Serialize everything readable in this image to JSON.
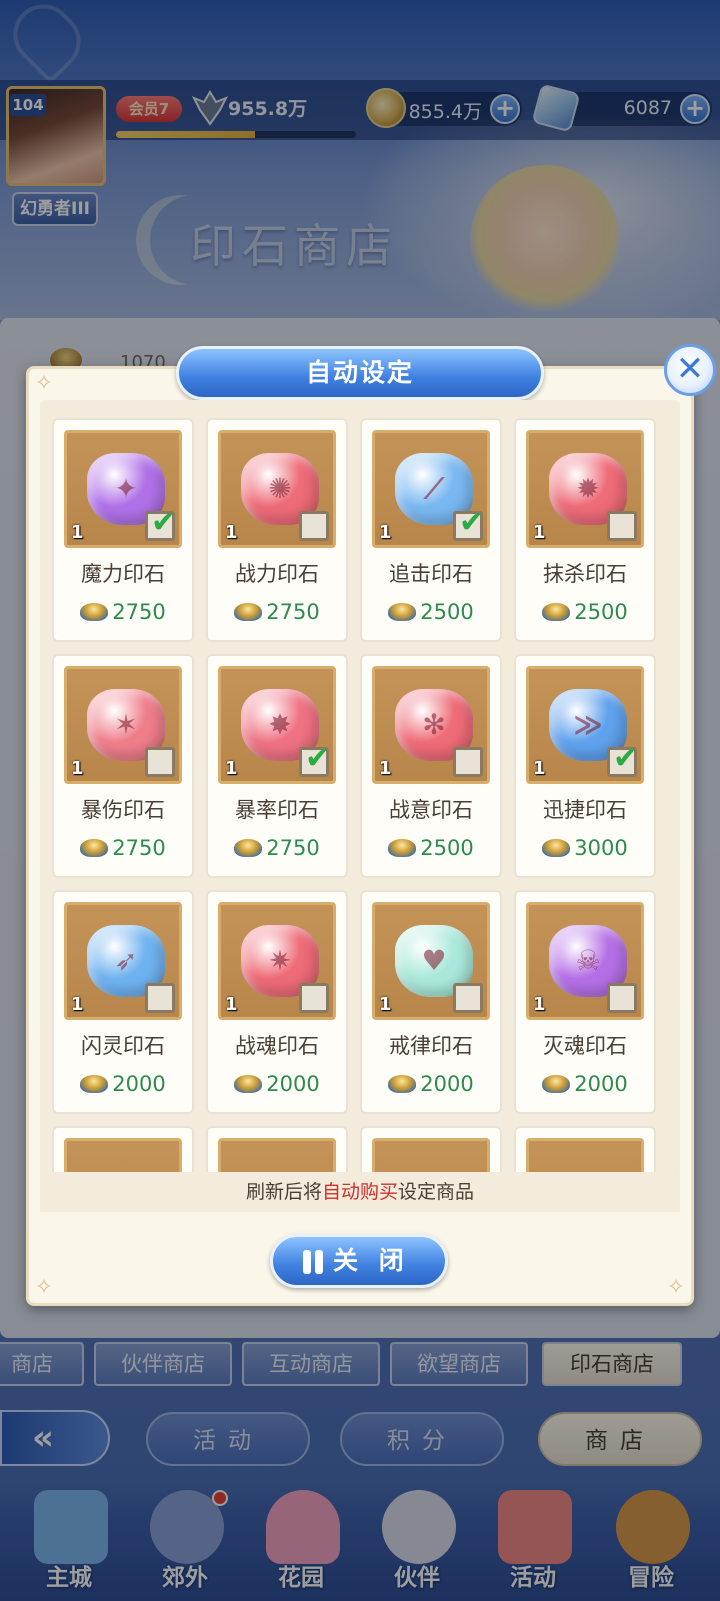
{
  "player": {
    "level": "104",
    "title": "幻勇者III",
    "vip": "会员7",
    "power": "955.8万",
    "exp_fraction": 0.58
  },
  "resources": {
    "coins": "855.4万",
    "gems": "6087",
    "plus": "+"
  },
  "shop": {
    "bg_title": "印石商店",
    "currency_value": "1070"
  },
  "modal": {
    "title": "自动设定",
    "close_glyph": "✕",
    "footnote_prefix": "刷新后将",
    "footnote_highlight": "自动购买",
    "footnote_suffix": "设定商品",
    "close_button": "关 闭"
  },
  "items": [
    {
      "name": "魔力印石",
      "qty": "1",
      "price": "2750",
      "checked": true,
      "color": "#b071e8",
      "glyph": "✦"
    },
    {
      "name": "战力印石",
      "qty": "1",
      "price": "2750",
      "checked": false,
      "color": "#ee6b78",
      "glyph": "✺"
    },
    {
      "name": "追击印石",
      "qty": "1",
      "price": "2500",
      "checked": true,
      "color": "#7ab8f2",
      "glyph": "⟋"
    },
    {
      "name": "抹杀印石",
      "qty": "1",
      "price": "2500",
      "checked": false,
      "color": "#ee6b78",
      "glyph": "✹"
    },
    {
      "name": "暴伤印石",
      "qty": "1",
      "price": "2750",
      "checked": false,
      "color": "#ef7d8a",
      "glyph": "✶"
    },
    {
      "name": "暴率印石",
      "qty": "1",
      "price": "2750",
      "checked": true,
      "color": "#ef7283",
      "glyph": "✸"
    },
    {
      "name": "战意印石",
      "qty": "1",
      "price": "2500",
      "checked": false,
      "color": "#ee6b78",
      "glyph": "✻"
    },
    {
      "name": "迅捷印石",
      "qty": "1",
      "price": "3000",
      "checked": true,
      "color": "#5fa1ec",
      "glyph": "≫"
    },
    {
      "name": "闪灵印石",
      "qty": "1",
      "price": "2000",
      "checked": false,
      "color": "#6fb2f0",
      "glyph": "➶"
    },
    {
      "name": "战魂印石",
      "qty": "1",
      "price": "2000",
      "checked": false,
      "color": "#ee6b78",
      "glyph": "✷"
    },
    {
      "name": "戒律印石",
      "qty": "1",
      "price": "2000",
      "checked": false,
      "color": "#a9e8da",
      "glyph": "♥"
    },
    {
      "name": "灭魂印石",
      "qty": "1",
      "price": "2000",
      "checked": false,
      "color": "#b56fe6",
      "glyph": "☠"
    }
  ],
  "shop_tabs": [
    {
      "label": "商店",
      "active": false
    },
    {
      "label": "伙伴商店",
      "active": false
    },
    {
      "label": "互动商店",
      "active": false
    },
    {
      "label": "欲望商店",
      "active": false
    },
    {
      "label": "印石商店",
      "active": true
    }
  ],
  "sub_tabs": [
    {
      "label": "活动",
      "active": false
    },
    {
      "label": "积分",
      "active": false
    },
    {
      "label": "商店",
      "active": true
    }
  ],
  "bottom_nav": [
    {
      "label": "主城",
      "color": "#7db7f0"
    },
    {
      "label": "郊外",
      "color": "#8aa0d8"
    },
    {
      "label": "花园",
      "color": "#f3a3c4"
    },
    {
      "label": "伙伴",
      "color": "#d8dcee"
    },
    {
      "label": "活动",
      "color": "#f08a8a"
    },
    {
      "label": "冒险",
      "color": "#d99a4e"
    }
  ],
  "colors": {
    "accent_blue": "#3f80e0",
    "price_green": "#2e8a4d",
    "highlight_red": "#d0302b",
    "check_green": "#2eaa43"
  }
}
